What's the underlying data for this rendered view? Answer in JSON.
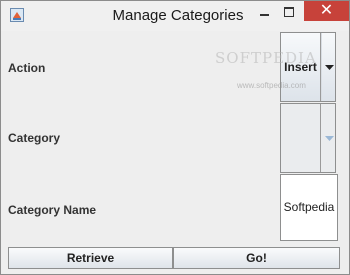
{
  "window": {
    "title": "Manage Categories",
    "close_glyph": "✕"
  },
  "form": {
    "action": {
      "label": "Action",
      "selected": "Insert"
    },
    "category": {
      "label": "Category",
      "selected": ""
    },
    "category_name": {
      "label": "Category Name",
      "value": "Softpedia"
    }
  },
  "buttons": {
    "retrieve_label": "Retrieve",
    "go_label": "Go!"
  },
  "watermark": {
    "text": "SOFTPEDIA",
    "url": "www.softpedia.com"
  },
  "colors": {
    "close_button": "#c7423a",
    "window_background": "#eeeeee",
    "disabled_arrow": "#9bb8d6"
  }
}
